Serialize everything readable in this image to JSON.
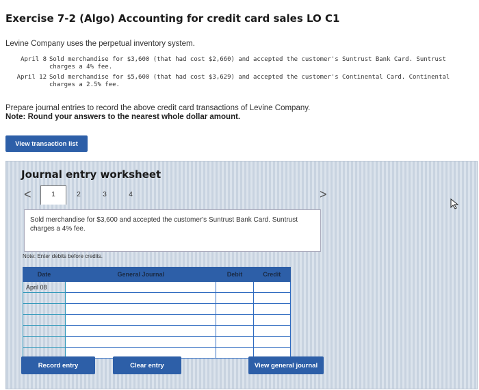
{
  "header": {
    "title": "Exercise 7-2 (Algo) Accounting for credit card sales LO C1"
  },
  "intro": "Levine Company uses the perpetual inventory system.",
  "transactions": [
    {
      "date": "April  8",
      "text": "Sold merchandise for $3,600 (that had cost $2,660) and accepted the customer's Suntrust Bank Card. Suntrust charges a 4% fee."
    },
    {
      "date": "April 12",
      "text": "Sold merchandise for $5,600 (that had cost $3,629) and accepted the customer's Continental Card. Continental charges a 2.5% fee."
    }
  ],
  "instructions": "Prepare journal entries to record the above credit card transactions of Levine Company.",
  "note": "Note: Round your answers to the nearest whole dollar amount.",
  "buttons": {
    "view_transactions": "View transaction list",
    "record_entry": "Record entry",
    "clear_entry": "Clear entry",
    "view_general_journal": "View general journal"
  },
  "worksheet": {
    "title": "Journal entry worksheet",
    "tabs": [
      "1",
      "2",
      "3",
      "4"
    ],
    "prev_icon": "<",
    "next_icon": ">",
    "description": "Sold merchandise for $3,600 and accepted the customer's Suntrust Bank Card. Suntrust charges a 4% fee.",
    "enter_note": "Note: Enter debits before credits.",
    "columns": [
      "Date",
      "General Journal",
      "Debit",
      "Credit"
    ],
    "rows": [
      {
        "date": "April 08"
      },
      {
        "date": ""
      },
      {
        "date": ""
      },
      {
        "date": ""
      },
      {
        "date": ""
      },
      {
        "date": ""
      },
      {
        "date": ""
      }
    ]
  }
}
